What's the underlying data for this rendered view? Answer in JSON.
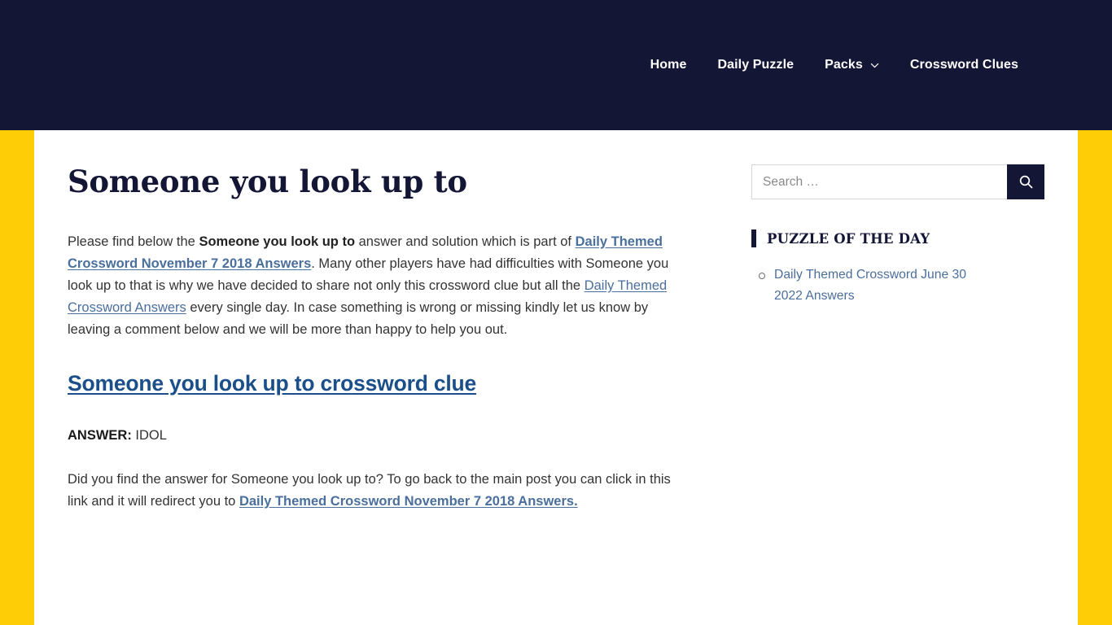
{
  "header": {
    "background_color": "#141636",
    "nav": [
      {
        "label": "Home",
        "has_dropdown": false
      },
      {
        "label": "Daily Puzzle",
        "has_dropdown": false
      },
      {
        "label": "Packs",
        "has_dropdown": true,
        "icon": "chevron-down-icon"
      },
      {
        "label": "Crossword Clues",
        "has_dropdown": false
      }
    ]
  },
  "theme": {
    "accent_yellow": "#ffcd05",
    "navy": "#141636",
    "link_blue": "#4a6f9c",
    "heading_link_blue": "#1b4f8a",
    "body_text": "#333333"
  },
  "article": {
    "title": "Someone you look up to",
    "intro": {
      "part1": "Please find below the ",
      "clue_bold": "Someone you look up to",
      "part2": " answer and solution which is part of ",
      "link1": "Daily Themed Crossword November 7 2018 Answers",
      "part3": ". Many other players have had difficulties with Someone you look up to that is why we have decided to share not only this crossword clue but all the ",
      "link2": "Daily Themed Crossword Answers",
      "part4": " every single day. In case something is wrong or missing kindly let us know by leaving a comment below and we will be more than happy to help you out."
    },
    "subheading_link": "Someone you look up to crossword clue",
    "answer_label": "ANSWER:",
    "answer_value": "IDOL",
    "closing": {
      "part1": "Did you find the answer for Someone you look up to? To go back to the main post you can click in this link and it will redirect you to ",
      "link": "Daily Themed Crossword November 7 2018 Answers."
    }
  },
  "sidebar": {
    "search": {
      "placeholder": "Search …",
      "value": "",
      "button_icon": "search-icon"
    },
    "widget": {
      "title": "PUZZLE OF THE DAY",
      "items": [
        {
          "label": "Daily Themed Crossword June 30 2022 Answers"
        }
      ]
    }
  }
}
